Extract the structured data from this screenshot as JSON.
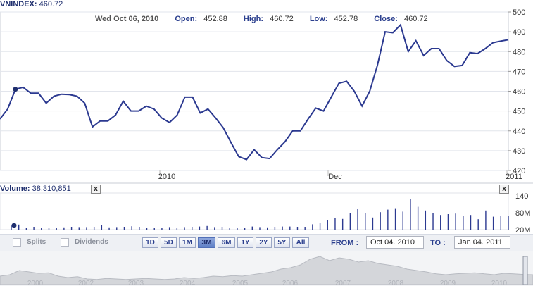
{
  "header": {
    "symbol_label": "VNINDEX:",
    "symbol_value": "460.72",
    "date": "Wed Oct 06, 2010",
    "open_label": "Open:",
    "open_value": "452.88",
    "high_label": "High:",
    "high_value": "460.72",
    "low_label": "Low:",
    "low_value": "452.78",
    "close_label": "Close:",
    "close_value": "460.72"
  },
  "volume_header": {
    "label": "Volume:",
    "value": "38,310,851"
  },
  "close_button": "x",
  "controls": {
    "splits_label": "Splits",
    "dividends_label": "Dividends",
    "zoom_buttons": [
      "1D",
      "5D",
      "1M",
      "3M",
      "6M",
      "1Y",
      "2Y",
      "5Y",
      "All"
    ],
    "active_zoom": "3M",
    "from_label": "FROM :",
    "from_value": "Oct 04. 2010",
    "to_label": "TO :",
    "to_value": "Jan 04. 2011"
  },
  "colors": {
    "line": "#2b3990",
    "marker": "#1f2f6e",
    "grid": "#e2e5ec",
    "nav_fill": "#d4d6da"
  },
  "chart_data": [
    {
      "type": "line",
      "ylim": [
        420,
        500
      ],
      "yticks": [
        420,
        430,
        440,
        450,
        460,
        470,
        480,
        490,
        500
      ],
      "xtick_labels": [
        "2010",
        "Dec",
        "2011"
      ],
      "values": [
        446,
        451,
        461,
        462,
        459,
        459,
        454,
        457.5,
        458.5,
        458.3,
        457.5,
        454,
        442,
        445,
        445,
        448,
        455,
        450,
        450,
        452.5,
        451,
        446.5,
        444.2,
        448,
        457,
        457,
        449,
        451,
        446.5,
        441.5,
        434,
        427,
        425.5,
        430.5,
        426.5,
        426,
        430.5,
        434.5,
        440,
        440,
        446,
        451.5,
        450,
        457,
        464,
        465,
        460,
        452.5,
        460,
        473,
        490,
        489.5,
        493.5,
        480,
        485.5,
        478,
        481.5,
        481.5,
        475.5,
        472.5,
        473,
        479.5,
        479,
        481.5,
        484.5,
        485.3,
        486
      ]
    },
    {
      "type": "bar",
      "series_name": "Volume",
      "ylim": [
        20,
        140
      ],
      "ytick_labels": [
        "140",
        "80M",
        "20M"
      ],
      "values": [
        34,
        38,
        26,
        30,
        27,
        27,
        27,
        28,
        30,
        29,
        29,
        30,
        35,
        28,
        29,
        30,
        32,
        30,
        27,
        27,
        27,
        29,
        27,
        29,
        30,
        31,
        33,
        29,
        30,
        26,
        27,
        27,
        31,
        29,
        28,
        30,
        31,
        31,
        30,
        30,
        39,
        44,
        53,
        60,
        58,
        80,
        93,
        80,
        63,
        82,
        91,
        96,
        84,
        128,
        101,
        88,
        79,
        72,
        75,
        77,
        68,
        72,
        57,
        88,
        66,
        70,
        68
      ]
    },
    {
      "type": "area",
      "x_labels": [
        "2000",
        "2002",
        "2003",
        "2004",
        "2005",
        "2006",
        "2007",
        "2008",
        "2009",
        "2010"
      ]
    }
  ]
}
